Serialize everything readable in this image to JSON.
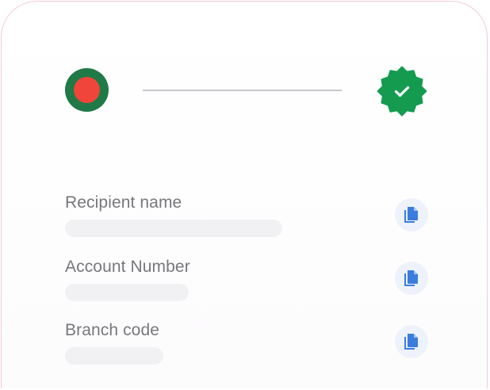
{
  "transfer": {
    "source_flag_icon": "bangladesh-flag-icon",
    "verified_icon": "verified-badge-icon",
    "colors": {
      "flag_green": "#1f7a47",
      "flag_red": "#f0453a",
      "verified_green": "#149b50",
      "copy_blue": "#3b7ddd",
      "copy_bg": "#eef2fb"
    }
  },
  "fields": [
    {
      "label": "Recipient name",
      "copy_icon": "copy-icon"
    },
    {
      "label": "Account Number",
      "copy_icon": "copy-icon"
    },
    {
      "label": "Branch code",
      "copy_icon": "copy-icon"
    }
  ]
}
